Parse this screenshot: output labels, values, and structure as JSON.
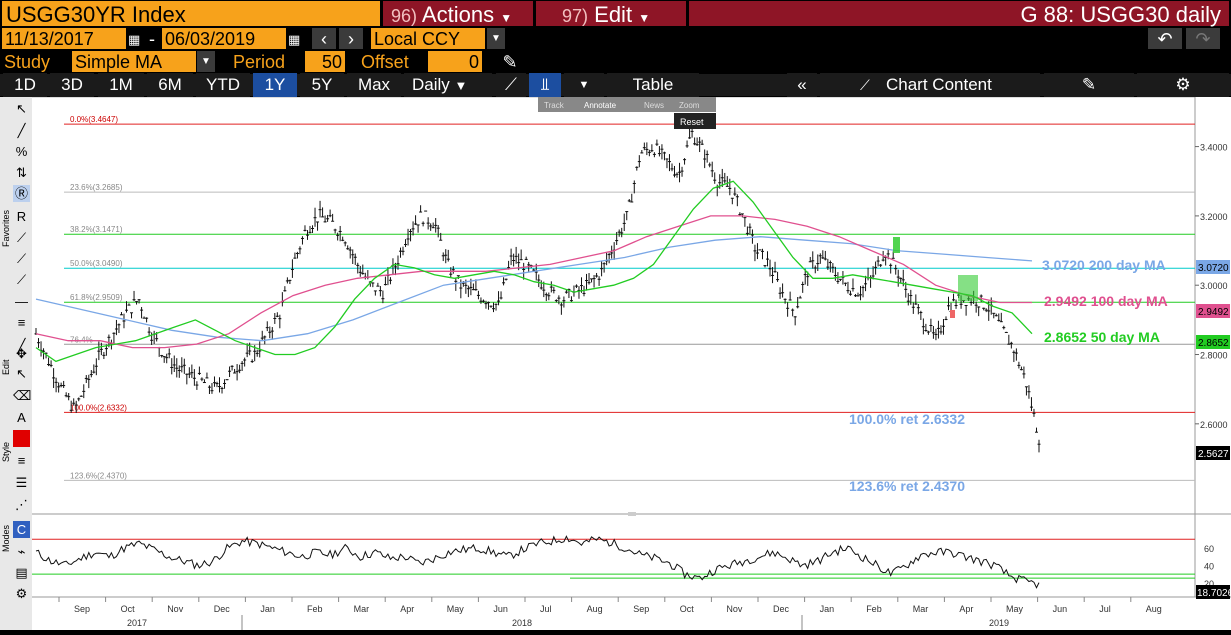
{
  "header": {
    "ticker": "USGG30YR Index",
    "actions_num": "96)",
    "actions_label": "Actions",
    "edit_num": "97)",
    "edit_label": "Edit",
    "page_title": "G 88: USGG30 daily"
  },
  "controls": {
    "start_date": "11/13/2017",
    "dash": "-",
    "end_date": "06/03/2019",
    "currency": "Local CCY",
    "study_label": "Study",
    "study_value": "Simple MA",
    "period_label": "Period",
    "period_value": "50",
    "offset_label": "Offset",
    "offset_value": "0"
  },
  "ranges": [
    "1D",
    "3D",
    "1M",
    "6M",
    "YTD",
    "1Y",
    "5Y",
    "Max"
  ],
  "active_range": "1Y",
  "frequency": "Daily",
  "table_label": "Table",
  "chart_content_label": "Chart Content",
  "sidebar_labels": {
    "favorites": "Favorites",
    "edit": "Edit",
    "style": "Style",
    "modes": "Modes"
  },
  "mini_toolbar": {
    "track": "Track",
    "annotate": "Annotate",
    "news": "News",
    "zoom": "Zoom",
    "reset": "Reset"
  },
  "fib_labels": [
    "0.0%(3.4647)",
    "23.6%(3.2685)",
    "38.2%(3.1471)",
    "50.0%(3.0490)",
    "61.8%(2.9509)",
    "76.4%",
    "100.0%(2.6332)",
    "123.6%(2.4370)"
  ],
  "annotations": {
    "ma200": "3.0720 200 day MA",
    "ma100": "2.9492 100 day MA",
    "ma50": "2.8652 50 day MA",
    "ret100": "100.0% ret 2.6332",
    "ret1236": "123.6% ret 2.4370"
  },
  "price_axis_ticks": [
    "3.4000",
    "3.2000",
    "3.0000",
    "2.8000",
    "2.6000"
  ],
  "price_axis_badges": {
    "ma200": "3.0720",
    "ma100": "2.9492",
    "ma50": "2.8652",
    "last": "2.5627"
  },
  "rsi_axis_ticks": [
    "60",
    "40",
    "20"
  ],
  "rsi_badge": "18.7026",
  "months": [
    "Sep",
    "Oct",
    "Nov",
    "Dec",
    "Jan",
    "Feb",
    "Mar",
    "Apr",
    "May",
    "Jun",
    "Jul",
    "Aug",
    "Sep",
    "Oct",
    "Nov",
    "Dec",
    "Jan",
    "Feb",
    "Mar",
    "Apr",
    "May",
    "Jun",
    "Jul",
    "Aug"
  ],
  "years": [
    "2017",
    "2018",
    "2019"
  ],
  "colors": {
    "orange": "#f7a21b",
    "bbg_red": "#8e1526",
    "ma50": "#22cc22",
    "ma100": "#e0508f",
    "ma200": "#7aa7e6",
    "fib_red": "#e02020",
    "fib_green": "#22cc22",
    "fib_cyan": "#00cccc"
  },
  "chart_data": {
    "type": "line",
    "y_range": [
      2.36,
      3.52
    ],
    "fib_levels": [
      {
        "label": "0.0%",
        "value": 3.4647
      },
      {
        "label": "23.6%",
        "value": 3.2685
      },
      {
        "label": "38.2%",
        "value": 3.1471
      },
      {
        "label": "50.0%",
        "value": 3.049
      },
      {
        "label": "61.8%",
        "value": 2.9509
      },
      {
        "label": "76.4%",
        "value": 2.8296
      },
      {
        "label": "100.0%",
        "value": 2.6332
      },
      {
        "label": "123.6%",
        "value": 2.437
      }
    ],
    "series": [
      {
        "name": "USGG30YR",
        "values": [
          2.86,
          2.78,
          2.7,
          2.64,
          2.72,
          2.8,
          2.86,
          2.92,
          2.96,
          2.86,
          2.8,
          2.76,
          2.74,
          2.72,
          2.7,
          2.74,
          2.78,
          2.8,
          2.86,
          2.92,
          3.06,
          3.16,
          3.2,
          3.18,
          3.14,
          3.06,
          3.0,
          2.98,
          3.06,
          3.16,
          3.2,
          3.18,
          3.06,
          3.0,
          2.98,
          2.96,
          2.94,
          3.08,
          3.06,
          3.02,
          2.98,
          2.96,
          2.98,
          3.0,
          3.04,
          3.12,
          3.2,
          3.38,
          3.4,
          3.36,
          3.32,
          3.44,
          3.38,
          3.3,
          3.28,
          3.2,
          3.1,
          3.06,
          2.98,
          2.92,
          3.04,
          3.08,
          3.04,
          3.0,
          2.98,
          3.02,
          3.1,
          3.04,
          2.96,
          2.9,
          2.84,
          2.94,
          2.96,
          2.96,
          2.94,
          2.88,
          2.82,
          2.72,
          2.56
        ]
      },
      {
        "name": "50 day MA",
        "values": [
          2.82,
          2.78,
          2.8,
          2.82,
          2.83,
          2.84,
          2.86,
          2.88,
          2.9,
          2.87,
          2.84,
          2.82,
          2.8,
          2.8,
          2.82,
          2.88,
          2.96,
          3.02,
          3.06,
          3.05,
          3.03,
          3.02,
          3.03,
          3.04,
          3.03,
          3.01,
          3.0,
          2.98,
          2.99,
          3.0,
          3.02,
          3.06,
          3.14,
          3.22,
          3.28,
          3.3,
          3.24,
          3.16,
          3.08,
          3.02,
          3.02,
          3.03,
          3.02,
          3.01,
          3.0,
          2.99,
          2.98,
          2.97,
          2.94,
          2.92,
          2.86
        ]
      },
      {
        "name": "100 day MA",
        "values": [
          2.86,
          2.84,
          2.84,
          2.82,
          2.82,
          2.83,
          2.86,
          2.92,
          2.97,
          3.0,
          3.02,
          3.03,
          3.04,
          3.04,
          3.04,
          3.05,
          3.06,
          3.08,
          3.1,
          3.14,
          3.17,
          3.2,
          3.2,
          3.19,
          3.17,
          3.14,
          3.1,
          3.06,
          3.0,
          2.97,
          2.95,
          2.95
        ]
      },
      {
        "name": "200 day MA",
        "values": [
          2.96,
          2.93,
          2.9,
          2.87,
          2.85,
          2.84,
          2.86,
          2.9,
          2.95,
          3.0,
          3.02,
          3.04,
          3.06,
          3.08,
          3.11,
          3.13,
          3.14,
          3.13,
          3.12,
          3.1,
          3.09,
          3.08,
          3.07
        ]
      },
      {
        "name": "RSI",
        "values": [
          55,
          45,
          40,
          48,
          55,
          50,
          60,
          65,
          58,
          50,
          45,
          40,
          45,
          60,
          68,
          65,
          60,
          55,
          50,
          55,
          52,
          60,
          50,
          55,
          48,
          50,
          42,
          48,
          55,
          58,
          60,
          55,
          50,
          58,
          65,
          68,
          72,
          65,
          70,
          66,
          60,
          52,
          48,
          42,
          30,
          25,
          35,
          40,
          45,
          50,
          55,
          48,
          40,
          45,
          55,
          60,
          50,
          40,
          30,
          40,
          52,
          55,
          55,
          50,
          45,
          40,
          28,
          22,
          18
        ]
      }
    ]
  }
}
